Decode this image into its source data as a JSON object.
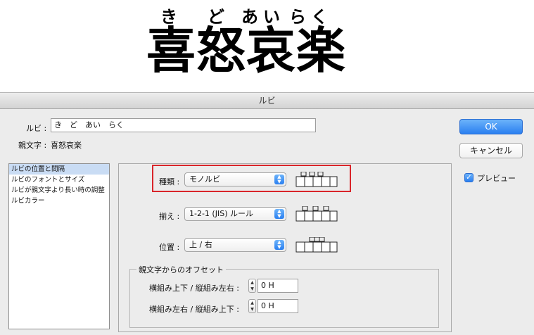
{
  "sample": {
    "ruby": [
      "き",
      "ど",
      "あ",
      "い",
      "ら",
      "く"
    ],
    "base": "喜怒哀楽"
  },
  "dialog": {
    "title": "ルビ",
    "ruby_label": "ルビ :",
    "ruby_value": "き　ど　あい　らく",
    "parent_label": "親文字 :",
    "parent_value": "喜怒哀楽",
    "ok": "OK",
    "cancel": "キャンセル",
    "preview_label": "プレビュー",
    "preview_checked": true,
    "sections": [
      "ルビの位置と間隔",
      "ルビのフォントとサイズ",
      "ルビが親文字より長い時の調整",
      "ルビカラー"
    ],
    "type_label": "種類 :",
    "type_value": "モノルビ",
    "align_label": "揃え :",
    "align_value": "1-2-1 (JIS) ルール",
    "position_label": "位置 :",
    "position_value": "上 / 右",
    "offset_group_title": "親文字からのオフセット",
    "offset1_label": "横組み上下 / 縦組み左右 :",
    "offset1_value": "0 H",
    "offset2_label": "横組み左右 / 縦組み上下 :",
    "offset2_value": "0 H",
    "highlight_color": "#d9252a",
    "accent_color": "#2a7ff0"
  }
}
